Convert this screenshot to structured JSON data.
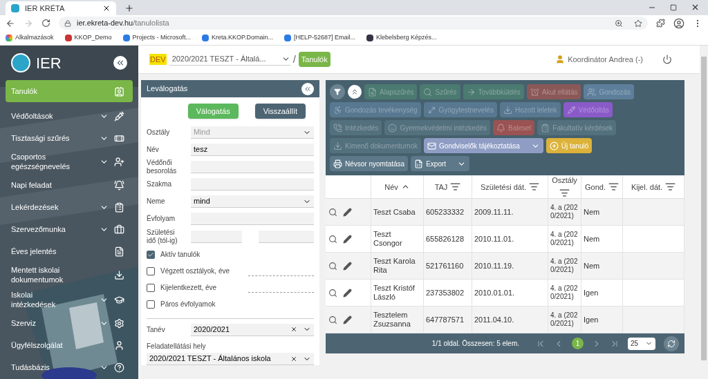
{
  "browser": {
    "tab_title": "IER KRÉTA",
    "url_host": "ier.ekreta-dev.hu",
    "url_path": "/tanulolista",
    "bookmarks": [
      "Alkalmazások",
      "KKOP_Demo",
      "Projects - Microsoft...",
      "Kreta.KKOP.Domain...",
      "[HELP-52687] Email...",
      "Klebelsberg Képzés..."
    ]
  },
  "logo": "IER",
  "header": {
    "env_badge": "DEV",
    "context": "2020/2021 TESZT - Általá...",
    "separator": "/",
    "page": "Tanulók",
    "user": "Koordinátor Andrea (-)"
  },
  "sidebar": {
    "items": [
      {
        "label": "Tanulók",
        "selected": true,
        "expandable": false
      },
      {
        "label": "Védőoltások",
        "selected": false,
        "expandable": true
      },
      {
        "label": "Tisztasági szűrés",
        "selected": false,
        "expandable": true
      },
      {
        "label": "Csoportos egészségnevelés",
        "selected": false,
        "expandable": true
      },
      {
        "label": "Napi feladat",
        "selected": false,
        "expandable": false
      },
      {
        "label": "Lekérdezések",
        "selected": false,
        "expandable": true
      },
      {
        "label": "Szervezőmunka",
        "selected": false,
        "expandable": true
      },
      {
        "label": "Éves jelentés",
        "selected": false,
        "expandable": false
      },
      {
        "label": "Mentett iskolai dokumentumok",
        "selected": false,
        "expandable": false
      },
      {
        "label": "Iskolai intézkedések",
        "selected": false,
        "expandable": true
      },
      {
        "label": "Szerviz",
        "selected": false,
        "expandable": true
      },
      {
        "label": "Ügyfélszolgálat",
        "selected": false,
        "expandable": false
      },
      {
        "label": "Tudásbázis",
        "selected": false,
        "expandable": true
      }
    ]
  },
  "filter": {
    "title": "Leválogatás",
    "buttons": [
      {
        "label": "Válogatás",
        "color": "#5cb85c"
      },
      {
        "label": "Visszaállít",
        "color": "#4d6573"
      }
    ],
    "fields": [
      {
        "kind": "select",
        "label": "Osztály",
        "placeholder": "Mind"
      },
      {
        "kind": "text",
        "label": "Név",
        "value": "tesz"
      },
      {
        "kind": "text",
        "label": "Védőnői besorolás"
      },
      {
        "kind": "text",
        "label": "Szakma"
      },
      {
        "kind": "select",
        "label": "Neme",
        "value": "mind"
      },
      {
        "kind": "text",
        "label": "Évfolyam"
      },
      {
        "kind": "range",
        "label": "Születési idő (tól-ig)"
      },
      {
        "kind": "checkbox",
        "label": "Aktív tanulók",
        "checked": true
      },
      {
        "kind": "checkbox-input",
        "label": "Végzett osztályok, éve",
        "checked": false
      },
      {
        "kind": "checkbox-input",
        "label": "Kijelentkezett, éve",
        "checked": false
      },
      {
        "kind": "checkbox",
        "label": "Páros évfolyamok",
        "checked": false
      },
      {
        "kind": "clearable-select",
        "label": "Tanév",
        "value": "2020/2021"
      },
      {
        "kind": "stacked-select",
        "label": "Feladatellátási hely",
        "value": "2020/2021 TESZT - Általános iskola"
      }
    ]
  },
  "toolbar": {
    "buttons": [
      {
        "label": "Alapszűrés",
        "color": "#4b7a70",
        "disabled": true,
        "dropdown": false
      },
      {
        "label": "Szűrés",
        "color": "#4b7a70",
        "disabled": true,
        "dropdown": false
      },
      {
        "label": "Továbbküldés",
        "color": "#4b7a70",
        "disabled": true,
        "dropdown": false
      },
      {
        "label": "Akut ellátás",
        "color": "#8b5858",
        "disabled": true,
        "dropdown": false
      },
      {
        "label": "Gondozás",
        "color": "#5e7f9c",
        "disabled": true,
        "dropdown": false
      },
      {
        "label": "Gondozás tevékenység",
        "color": "#587891",
        "disabled": true,
        "dropdown": false
      },
      {
        "label": "Gyógytestnevelés",
        "color": "#587891",
        "disabled": true,
        "dropdown": false
      },
      {
        "label": "Hozott leletek",
        "color": "#587891",
        "disabled": true,
        "dropdown": false
      },
      {
        "label": "Védőoltás",
        "color": "#8a5bc8",
        "disabled": true,
        "dropdown": false
      },
      {
        "label": "Intézkedés",
        "color": "#53707e",
        "disabled": true,
        "dropdown": false
      },
      {
        "label": "Gyermekvédelmi intézkedés",
        "color": "#53707e",
        "disabled": true,
        "dropdown": false
      },
      {
        "label": "Baleset",
        "color": "#9a5252",
        "disabled": true,
        "dropdown": false
      },
      {
        "label": "Fakultatív kérdések",
        "color": "#53707e",
        "disabled": true,
        "dropdown": false
      },
      {
        "label": "Kimenő dokumentumok",
        "color": "#53707e",
        "disabled": true,
        "dropdown": false
      },
      {
        "label": "Gondviselők tájékoztatása",
        "color": "#8f9dc4",
        "disabled": false,
        "dropdown": true
      },
      {
        "label": "Új tanuló",
        "color": "#dcb23a",
        "disabled": false,
        "dropdown": false
      },
      {
        "label": "Névsor nyomtatása",
        "color": "#5d7888",
        "disabled": false,
        "dropdown": false
      },
      {
        "label": "Export",
        "color": "#5d7888",
        "disabled": false,
        "dropdown": true
      }
    ]
  },
  "table": {
    "columns": [
      {
        "label": "Név",
        "sorted": true
      },
      {
        "label": "TAJ",
        "sorted": false
      },
      {
        "label": "Születési dát.",
        "sorted": false
      },
      {
        "label": "Osztály",
        "sorted": false
      },
      {
        "label": "Gond.",
        "sorted": false
      },
      {
        "label": "Kijel. dát.",
        "sorted": false
      }
    ],
    "rows": [
      {
        "cells": [
          "Teszt Csaba",
          "605233332",
          "2009.11.11.",
          "4. a (2020/2021)",
          "Nem",
          ""
        ]
      },
      {
        "cells": [
          "Teszt Csongor",
          "655826128",
          "2010.11.01.",
          "4. a (2020/2021)",
          "Nem",
          ""
        ]
      },
      {
        "cells": [
          "Teszt Karola Rita",
          "521761160",
          "2010.11.19.",
          "4. a (2020/2021)",
          "Nem",
          ""
        ]
      },
      {
        "cells": [
          "Teszt Kristóf László",
          "237353802",
          "2010.01.01.",
          "4. a (2020/2021)",
          "Igen",
          ""
        ]
      },
      {
        "cells": [
          "Tesztelem Zsuzsanna",
          "647787571",
          "2011.04.10.",
          "4. a (2020/2021)",
          "Igen",
          ""
        ]
      }
    ]
  },
  "pager": {
    "summary": "1/1 oldal. Összesen: 5 elem.",
    "pages": [
      {
        "label": "1",
        "selected": true
      }
    ],
    "page_size": "25"
  }
}
